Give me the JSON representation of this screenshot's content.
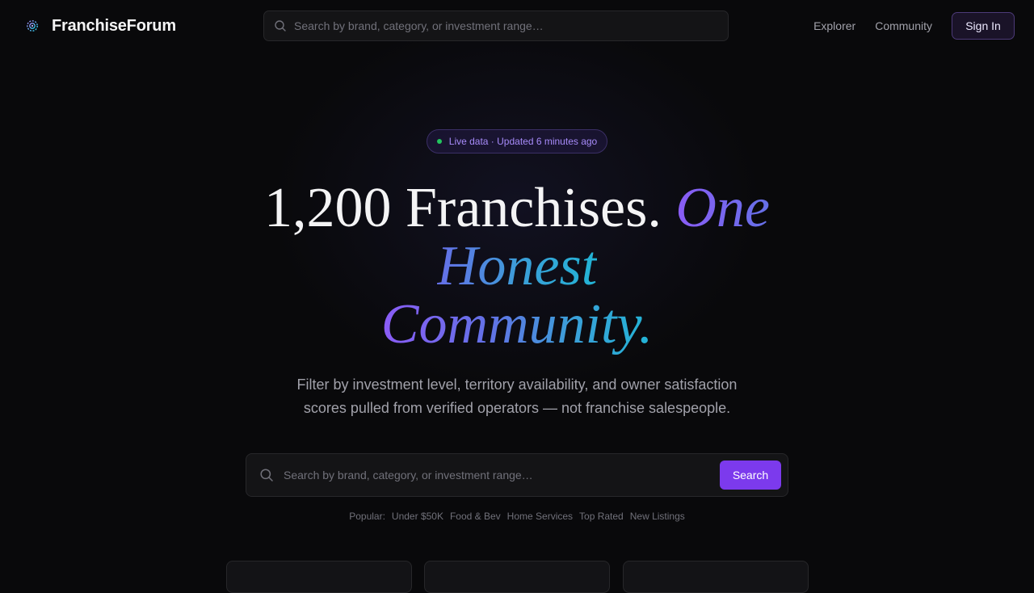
{
  "header": {
    "brand": "FranchiseForum",
    "search_placeholder": "Search by brand, category, or investment range…",
    "nav": {
      "explorer": "Explorer",
      "community": "Community",
      "sign_in": "Sign In"
    }
  },
  "hero": {
    "badge": "Live data · Updated 6 minutes ago",
    "headline_plain": "1,200 Franchises. ",
    "headline_accent_1": "One Honest",
    "headline_accent_2": "Community.",
    "subtitle": "Filter by investment level, territory availability, and owner satisfaction scores pulled from verified operators — not franchise salespeople.",
    "search_placeholder": "Search by brand, category, or investment range…",
    "search_button": "Search",
    "popular_label": "Popular:",
    "popular_tags": [
      "Under $50K",
      "Food & Bev",
      "Home Services",
      "Top Rated",
      "New Listings"
    ]
  },
  "colors": {
    "accent": "#7c3aed",
    "live_dot": "#22c55e",
    "background": "#09090b"
  },
  "icons": {
    "brand": "sparkle-gear-icon",
    "search": "search-icon"
  }
}
